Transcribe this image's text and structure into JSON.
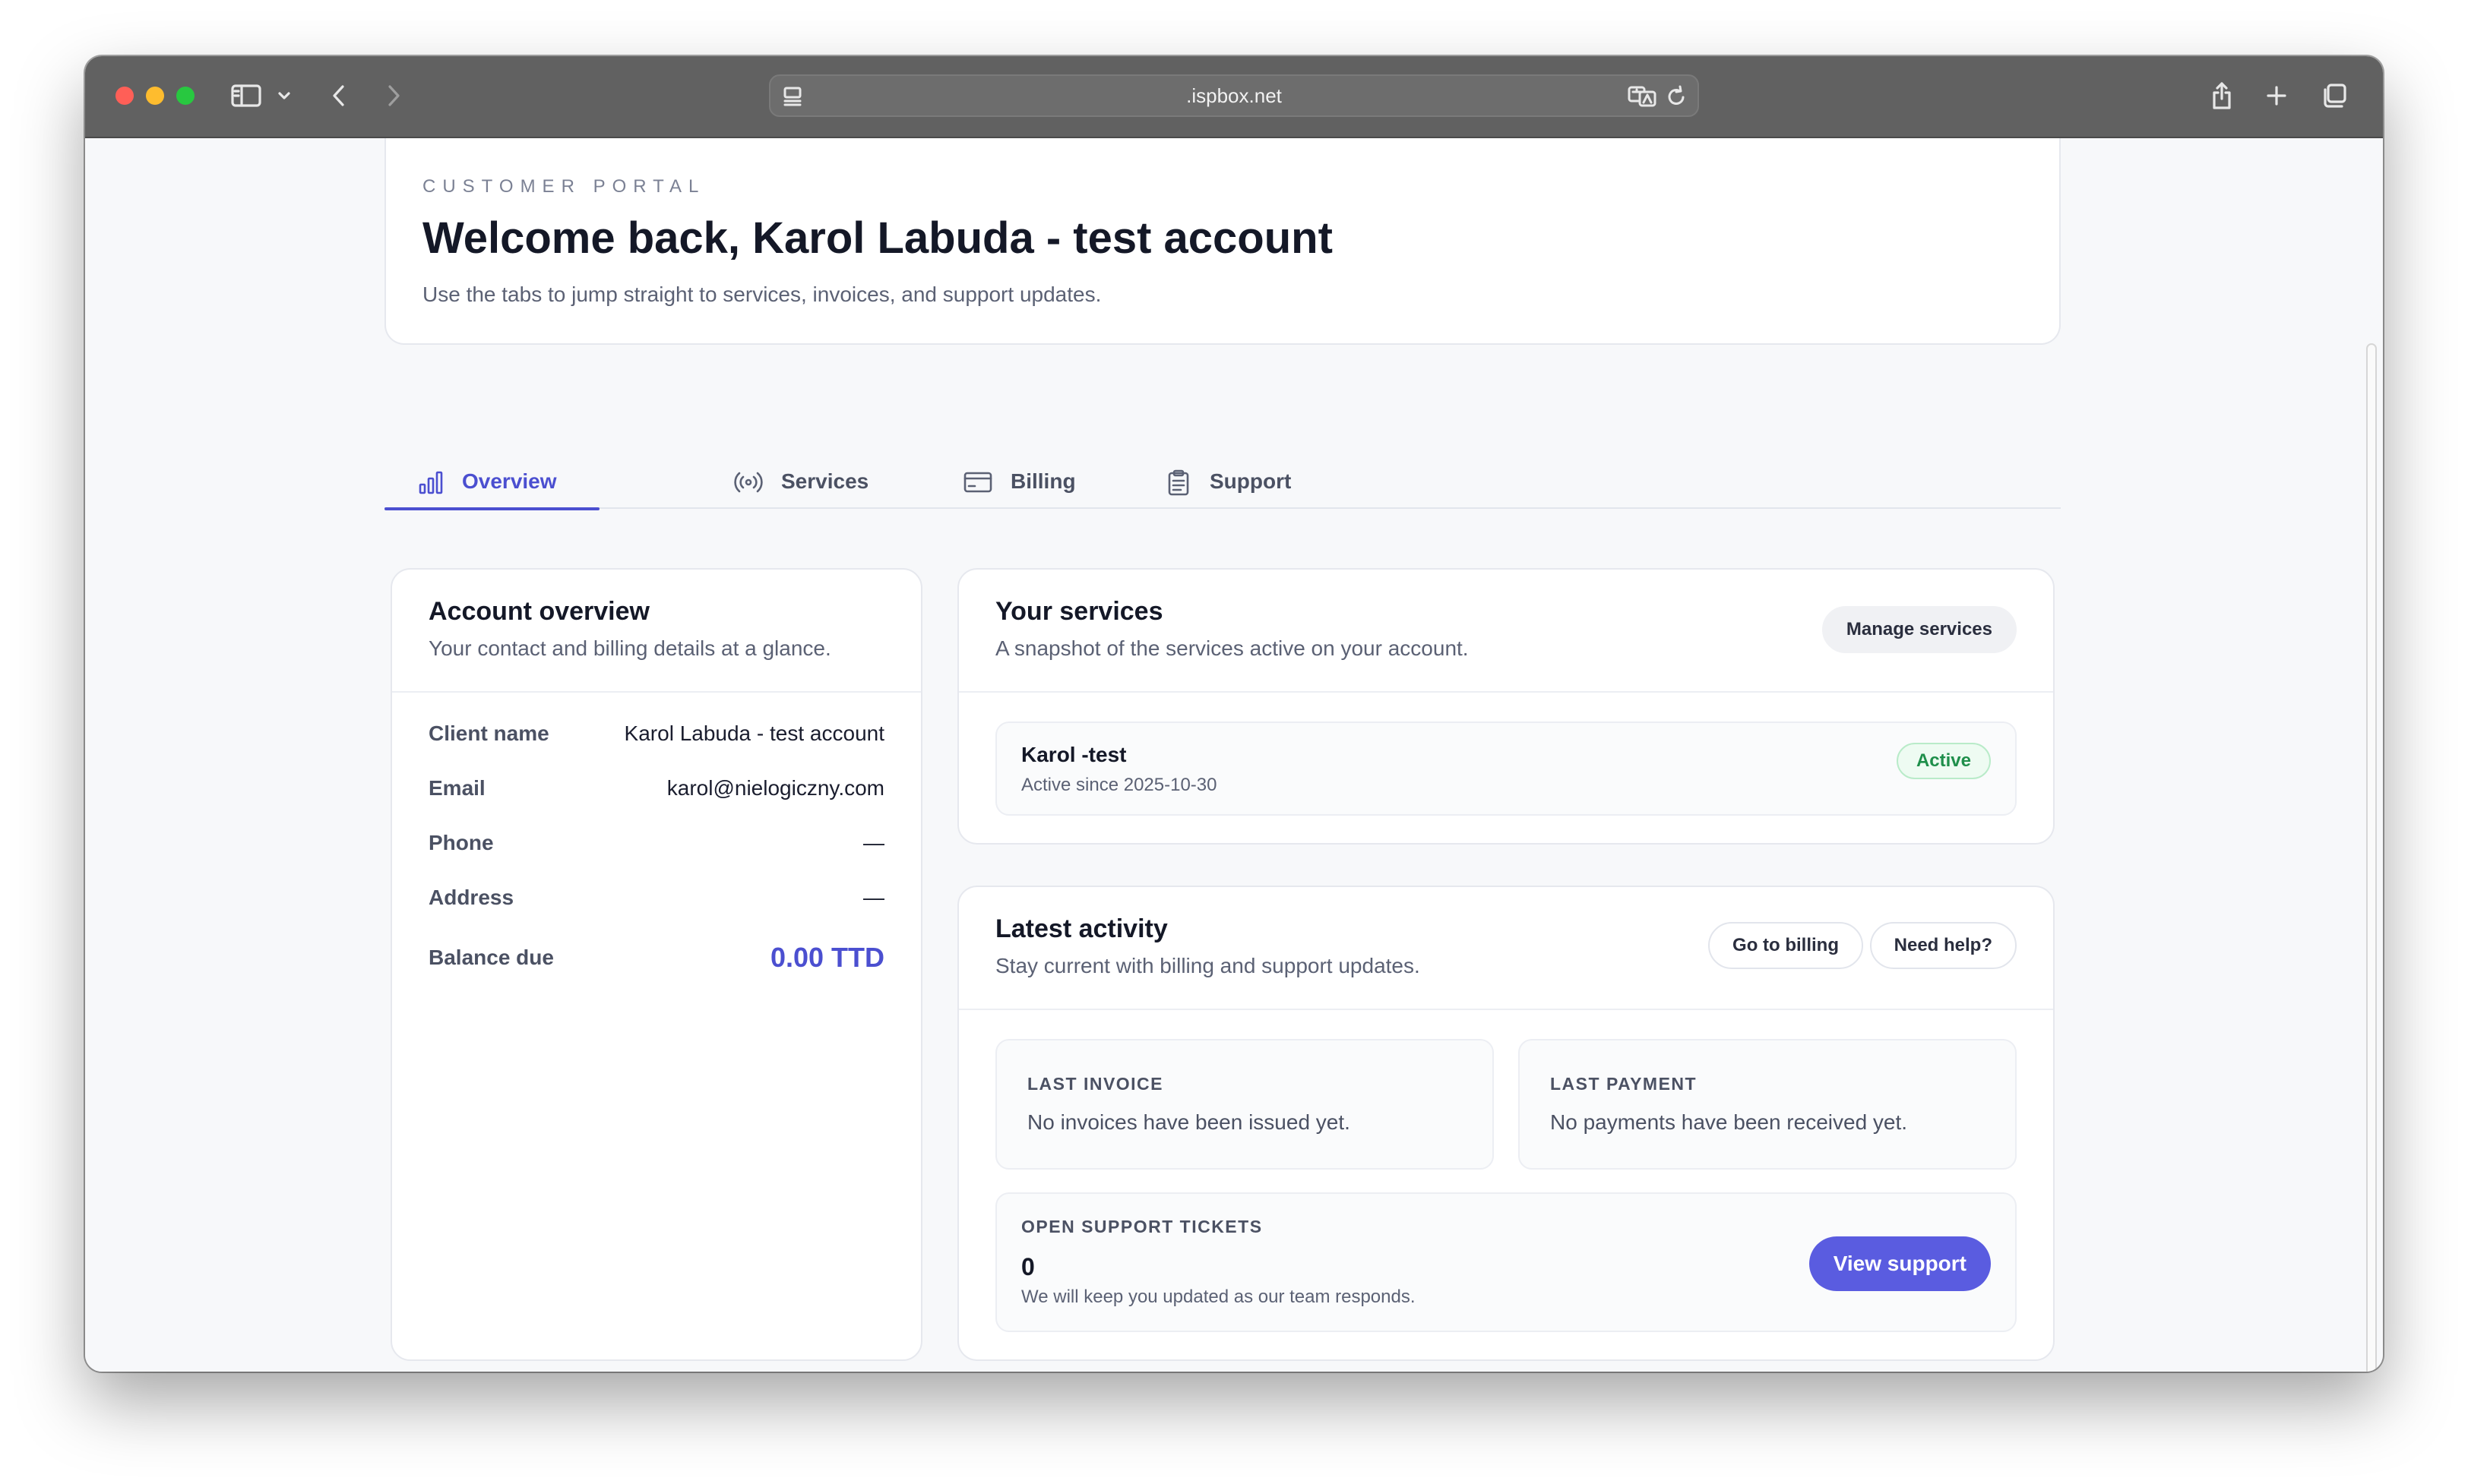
{
  "browser": {
    "url": ".ispbox.net"
  },
  "hero": {
    "eyebrow": "CUSTOMER PORTAL",
    "title": "Welcome back, Karol Labuda - test account",
    "subtitle": "Use the tabs to jump straight to services, invoices, and support updates."
  },
  "tabs": [
    {
      "label": "Overview",
      "icon": "bar-chart-icon",
      "active": true
    },
    {
      "label": "Services",
      "icon": "broadcast-icon",
      "active": false
    },
    {
      "label": "Billing",
      "icon": "credit-card-icon",
      "active": false
    },
    {
      "label": "Support",
      "icon": "clipboard-icon",
      "active": false
    }
  ],
  "account": {
    "title": "Account overview",
    "subtitle": "Your contact and billing details at a glance.",
    "fields": [
      {
        "label": "Client name",
        "value": "Karol Labuda - test account"
      },
      {
        "label": "Email",
        "value": "karol@nielogiczny.com"
      },
      {
        "label": "Phone",
        "value": "—"
      },
      {
        "label": "Address",
        "value": "—"
      },
      {
        "label": "Balance due",
        "value": "0.00 TTD"
      }
    ]
  },
  "services": {
    "title": "Your services",
    "subtitle": "A snapshot of the services active on your account.",
    "manage_label": "Manage services",
    "items": [
      {
        "name": "Karol -test",
        "since": "Active since 2025-10-30",
        "status": "Active"
      }
    ]
  },
  "activity": {
    "title": "Latest activity",
    "subtitle": "Stay current with billing and support updates.",
    "billing_label": "Go to billing",
    "help_label": "Need help?",
    "last_invoice_label": "LAST INVOICE",
    "last_invoice_text": "No invoices have been issued yet.",
    "last_payment_label": "LAST PAYMENT",
    "last_payment_text": "No payments have been received yet.",
    "tickets_label": "OPEN SUPPORT TICKETS",
    "tickets_count": "0",
    "tickets_note": "We will keep you updated as our team responds.",
    "view_support_label": "View support"
  },
  "colors": {
    "accent": "#4b4fd0",
    "primary_button": "#5a5ce0",
    "success": "#1f8f4b",
    "toolbar": "#616161"
  }
}
